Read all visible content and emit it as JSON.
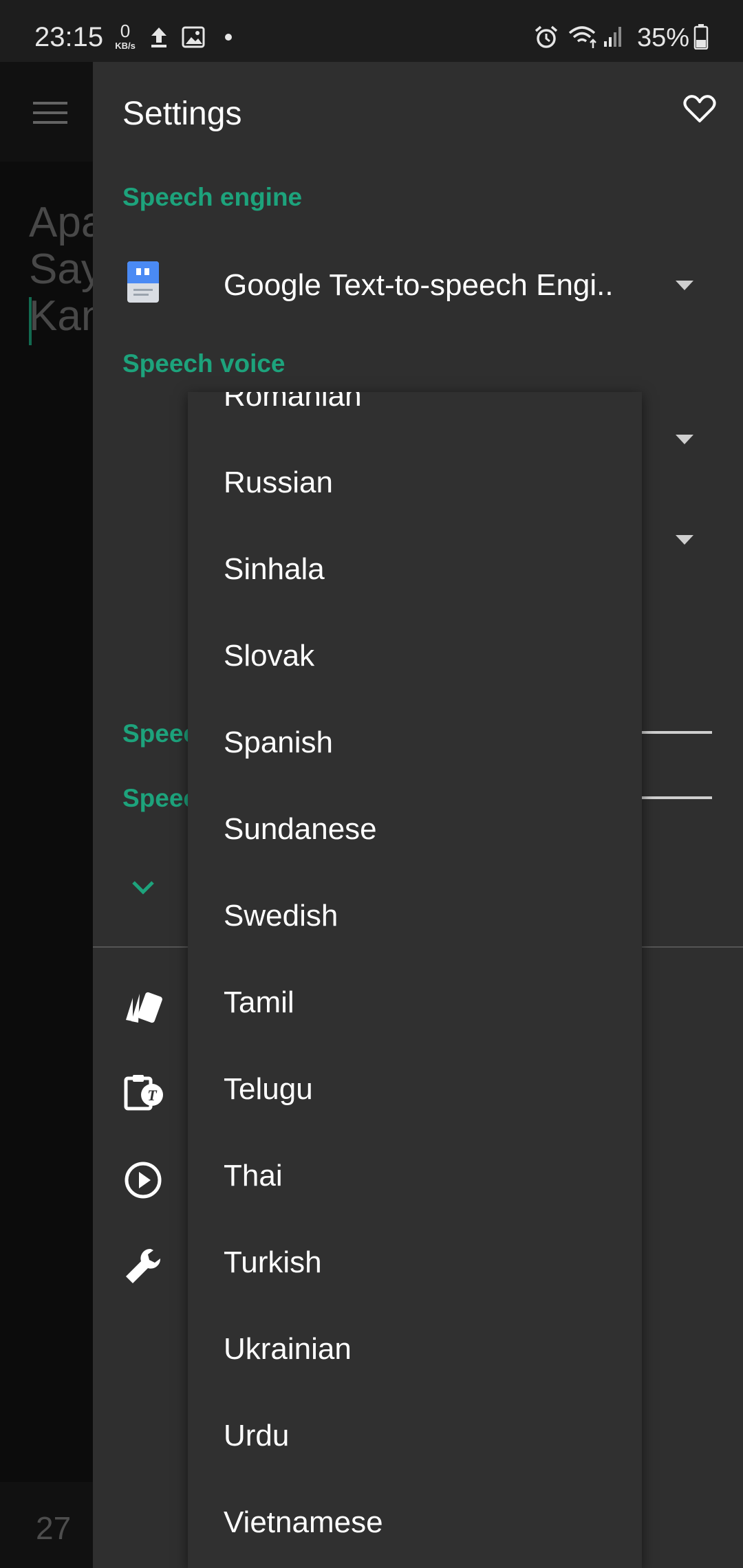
{
  "status_bar": {
    "time": "23:15",
    "net_speed_value": "0",
    "net_speed_unit": "KB/s",
    "battery_percent": "35%",
    "icons": [
      "upload-icon",
      "image-icon",
      "dot-icon",
      "alarm-icon",
      "wifi-icon",
      "signal-icon",
      "battery-icon"
    ]
  },
  "background": {
    "text_lines": [
      "Apa",
      "Say",
      "Kan"
    ],
    "counter": "27"
  },
  "drawer": {
    "title": "Settings",
    "speech_engine_label": "Speech engine",
    "engine_name": "Google Text-to-speech Engi..",
    "speech_voice_label": "Speech voice",
    "speed_label_1": "Speec",
    "speed_label_2": "Speec",
    "accent_color": "#1da37c"
  },
  "language_list": {
    "items": [
      "Romanian",
      "Russian",
      "Sinhala",
      "Slovak",
      "Spanish",
      "Sundanese",
      "Swedish",
      "Tamil",
      "Telugu",
      "Thai",
      "Turkish",
      "Ukrainian",
      "Urdu",
      "Vietnamese"
    ]
  }
}
